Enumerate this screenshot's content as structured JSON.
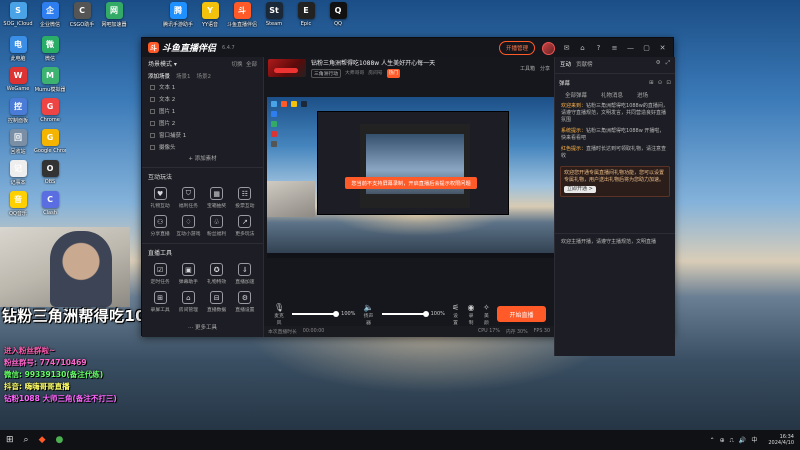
{
  "desktop": {
    "icons": [
      {
        "label": "SOG_iCloud",
        "glyph": "S",
        "color": "#4aa3e6"
      },
      {
        "label": "企业微信",
        "glyph": "企",
        "color": "#2f7ef0"
      },
      {
        "label": "CSGO助手",
        "glyph": "C",
        "color": "#555"
      },
      {
        "label": "网吧加速器",
        "glyph": "网",
        "color": "#3a6"
      },
      {
        "label": "腾讯手游助手",
        "glyph": "腾",
        "color": "#1e90ff"
      },
      {
        "label": "YY语音",
        "glyph": "Y",
        "color": "#f4c20d"
      },
      {
        "label": "斗鱼直播伴侣",
        "glyph": "斗",
        "color": "#ff5a28"
      },
      {
        "label": "Steam",
        "glyph": "St",
        "color": "#1b2838"
      },
      {
        "label": "Epic",
        "glyph": "E",
        "color": "#222"
      },
      {
        "label": "QQ",
        "glyph": "Q",
        "color": "#111"
      },
      {
        "label": "此电脑",
        "glyph": "电",
        "color": "#3a8ee6"
      },
      {
        "label": "微信",
        "glyph": "微",
        "color": "#2aae67"
      },
      {
        "label": "WeGame",
        "glyph": "W",
        "color": "#d33"
      },
      {
        "label": "Mumu模拟器",
        "glyph": "M",
        "color": "#3cb371"
      },
      {
        "label": "控制面板",
        "glyph": "控",
        "color": "#4a7bd6"
      },
      {
        "label": "Chrome",
        "glyph": "G",
        "color": "#e44"
      },
      {
        "label": "回收站",
        "glyph": "回",
        "color": "#7a8fa6"
      },
      {
        "label": "Google Chrome",
        "glyph": "G",
        "color": "#f4b400"
      },
      {
        "label": "记事本",
        "glyph": "记",
        "color": "#eee"
      },
      {
        "label": "OBS",
        "glyph": "O",
        "color": "#333"
      },
      {
        "label": "QQ音乐",
        "glyph": "音",
        "color": "#ffd000"
      },
      {
        "label": "Clash",
        "glyph": "C",
        "color": "#5b6ee1"
      },
      {
        "label": "PixPin",
        "glyph": "P",
        "color": "#2db7f5"
      },
      {
        "label": "直播工具",
        "glyph": "直",
        "color": "#e24"
      }
    ]
  },
  "overlay": {
    "streamer_title": "钻粉三角洲帮得吃1088w",
    "promo_lines": [
      {
        "text": "进入粉丝群啦~",
        "color": "#ff5ab0"
      },
      {
        "text": "粉丝群号: 774710469",
        "color": "#ff66cc"
      },
      {
        "text": "微信: 99339130(备注代练)",
        "color": "#66ff66"
      },
      {
        "text": "抖音: 嗨嗨哥哥直播",
        "color": "#ffff66"
      },
      {
        "text": "钻粉1088   大师三角(备注不打三)",
        "color": "#ff66ff"
      }
    ]
  },
  "app": {
    "name": "斗鱼直播伴侣",
    "version": "6.4.7",
    "top_buttons": {
      "live_manage": "开播管理",
      "minimize": "—",
      "restore": "▢",
      "close": "✕"
    },
    "left_panel": {
      "scene_header": "场景模式",
      "scene_actions": [
        "切换",
        "全部"
      ],
      "scene_tabs": [
        "添加场景",
        "场景1",
        "场景2"
      ],
      "sources": [
        {
          "name": "文本 1",
          "tag": "👁"
        },
        {
          "name": "文本 2",
          "tag": "👁"
        },
        {
          "name": "图片 1",
          "tag": "👁"
        },
        {
          "name": "图片 2",
          "tag": "👁"
        },
        {
          "name": "窗口捕获 1",
          "tag": "👁"
        },
        {
          "name": "摄像头",
          "tag": "👁"
        }
      ],
      "add_source": "+ 添加素材",
      "tools1_header": "互动玩法",
      "tools1": [
        {
          "label": "礼物互动",
          "glyph": "♥"
        },
        {
          "label": "福利任务",
          "glyph": "⛉"
        },
        {
          "label": "宝箱抽奖",
          "glyph": "▦"
        },
        {
          "label": "投票互动",
          "glyph": "☷"
        },
        {
          "label": "分享直播",
          "glyph": "⚇"
        },
        {
          "label": "互动小游戏",
          "glyph": "♢"
        },
        {
          "label": "粉丝福利",
          "glyph": "♧"
        },
        {
          "label": "更多玩法",
          "glyph": "↗"
        }
      ],
      "tools2_header": "直播工具",
      "tools2": [
        {
          "label": "定时任务",
          "glyph": "☑"
        },
        {
          "label": "弹幕助手",
          "glyph": "▣"
        },
        {
          "label": "礼物特效",
          "glyph": "✪"
        },
        {
          "label": "直播加速",
          "glyph": "⇓"
        },
        {
          "label": "录屏工具",
          "glyph": "⊞"
        },
        {
          "label": "房间管理",
          "glyph": "⌂"
        },
        {
          "label": "直播数据",
          "glyph": "⊟"
        },
        {
          "label": "直播设置",
          "glyph": "⚙"
        }
      ],
      "more_tools": "··· 更多工具"
    },
    "center": {
      "room_title": "钻粉三角洲帮得吃1088w 人生美好开心每一天",
      "room_meta": [
        "三角洲行动",
        "大师哥哥",
        "房间号"
      ],
      "room_hot": "热门",
      "room_actions": [
        "工具箱",
        "分享"
      ],
      "toast": "您当前不支持屏幕录制，开启直播后会提示权限问题",
      "controls": {
        "mic_label": "麦克风",
        "mic_pct": "100%",
        "mic_level": 1.0,
        "speaker_label": "扬声器",
        "speaker_pct": "100%",
        "speaker_level": 1.0,
        "settings": "设置",
        "record": "录制",
        "beauty": "美颜",
        "start": "开始直播"
      },
      "status": [
        "本次直播时长",
        "00:00:00",
        "CPU 17%",
        "内存 30%",
        "FPS 30"
      ]
    },
    "right_panel": {
      "tabs": [
        "互动",
        "贡献榜"
      ],
      "chat_tab": "弹幕",
      "sub_tabs": [
        "全部弹幕",
        "礼物消息",
        "进场"
      ],
      "messages": [
        {
          "user": "欢迎来到",
          "text": "钻粉三角洲帮得吃1088w的直播间，请遵守直播规范，文明发言，共同营造良好直播氛围"
        },
        {
          "user": "系统提示",
          "text": "钻粉三角洲帮得吃1088w 开播啦，快来看看吧"
        },
        {
          "user": "红色提示",
          "text": "直播时长达到可领取礼物，请注意查收"
        }
      ],
      "gift_box": "欢迎您开通专属直播间礼物功能，您可以设置专属礼物，用户送出礼物后将为您助力加速。",
      "gift_btn": "立即开通 >",
      "footer_msg": "欢迎主播开播，请遵守主播规范，文明直播"
    }
  },
  "taskbar": {
    "time": "16:34",
    "date": "2024/4/10",
    "tray_items": [
      "⌃",
      "⊕",
      "⎍",
      "🔊",
      "中"
    ]
  }
}
